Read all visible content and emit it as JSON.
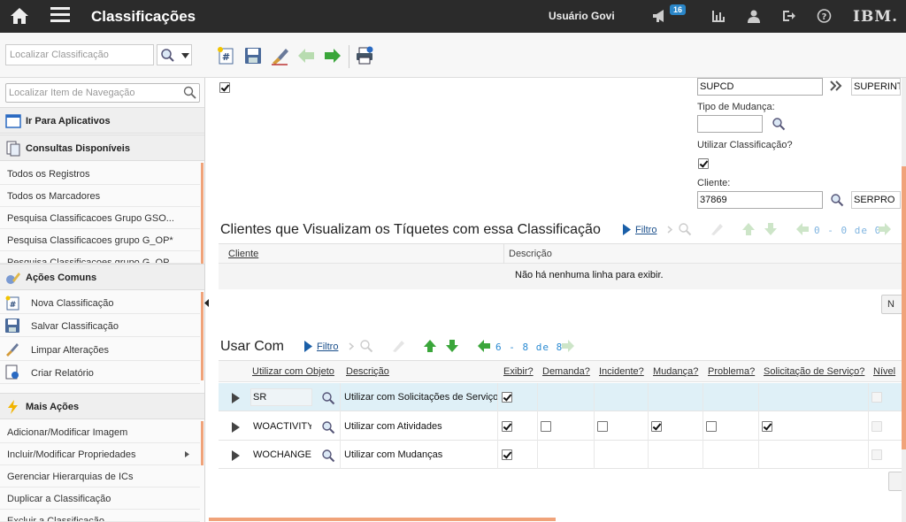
{
  "header": {
    "app_title": "Classificações",
    "user_name": "Usuário Govi",
    "notification_count": "16",
    "brand": "IBM."
  },
  "toolbar": {
    "search_placeholder": "Localizar Classificação"
  },
  "sidebar": {
    "nav_search_placeholder": "Localizar Item de Navegação",
    "go_to_apps": "Ir Para Aplicativos",
    "queries_title": "Consultas Disponíveis",
    "queries": [
      "Todos os Registros",
      "Todos os Marcadores",
      "Pesquisa Classificacoes Grupo GSO...",
      "Pesquisa Classificacoes grupo G_OP*",
      "Pesquisa Classificacoes grupo G_OP"
    ],
    "common_actions_title": "Ações Comuns",
    "common_actions": [
      "Nova Classificação",
      "Salvar Classificação",
      "Limpar Alterações",
      "Criar Relatório"
    ],
    "more_actions_title": "Mais Ações",
    "more_actions": [
      "Adicionar/Modificar Imagem",
      "Incluir/Modificar Propriedades",
      "Gerenciar Hierarquias de ICs",
      "Duplicar a Classificação",
      "Excluir a Classificação"
    ]
  },
  "form": {
    "supcd_value": "SUPCD",
    "superint_value": "SUPERINT",
    "tipo_mudanca_label": "Tipo de Mudança:",
    "utilizar_label": "Utilizar Classificação?",
    "cliente_label": "Cliente:",
    "cliente_value": "37869",
    "cliente_desc": "SERPRO"
  },
  "clientes_section": {
    "title": "Clientes que Visualizam os Tíquetes com essa Classificação",
    "filter_label": "Filtro",
    "pager": "0 - 0 de 0",
    "columns": [
      "Cliente",
      "Descrição"
    ],
    "empty_text": "Não há nenhuma linha para exibir.",
    "button_label": "N"
  },
  "usar_com_section": {
    "title": "Usar Com",
    "filter_label": "Filtro",
    "pager": "6 - 8 de 8",
    "columns": [
      "Utilizar com Objeto",
      "Descrição",
      "Exibir?",
      "Demanda?",
      "Incidente?",
      "Mudança?",
      "Problema?",
      "Solicitação de Serviço?",
      "Nível"
    ],
    "rows": [
      {
        "object": "SR",
        "description": "Utilizar com Solicitações de Serviço",
        "exibir": true,
        "demanda": null,
        "incidente": null,
        "mudanca": null,
        "problema": null,
        "solicitacao": null
      },
      {
        "object": "WOACTIVITY",
        "description": "Utilizar com Atividades",
        "exibir": true,
        "demanda": false,
        "incidente": false,
        "mudanca": true,
        "problema": false,
        "solicitacao": true
      },
      {
        "object": "WOCHANGE",
        "description": "Utilizar com Mudanças",
        "exibir": true,
        "demanda": null,
        "incidente": null,
        "mudanca": null,
        "problema": null,
        "solicitacao": null
      }
    ]
  },
  "colors": {
    "header_bg": "#2b2b2b",
    "accent_orange": "#f0a37a",
    "link_blue": "#1a4f8b",
    "selected_row": "#dff0f7",
    "arrow_green": "#3aa63a"
  }
}
